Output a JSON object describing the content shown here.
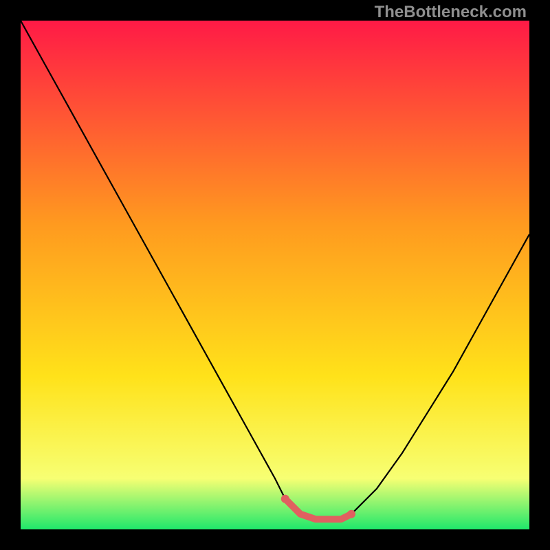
{
  "watermark": "TheBottleneck.com",
  "colors": {
    "frame": "#000000",
    "gradient_top": "#ff1a46",
    "gradient_mid1": "#ff9a1f",
    "gradient_mid2": "#ffe21a",
    "gradient_low": "#f7ff73",
    "gradient_bottom": "#1fe86b",
    "curve": "#000000",
    "segment": "#e06060"
  },
  "chart_data": {
    "type": "line",
    "title": "",
    "xlabel": "",
    "ylabel": "",
    "xlim": [
      0,
      100
    ],
    "ylim": [
      0,
      100
    ],
    "series": [
      {
        "name": "bottleneck-curve",
        "x": [
          0,
          5,
          10,
          15,
          20,
          25,
          30,
          35,
          40,
          45,
          50,
          52,
          55,
          58,
          60,
          63,
          65,
          70,
          75,
          80,
          85,
          90,
          95,
          100
        ],
        "y": [
          100,
          91,
          82,
          73,
          64,
          55,
          46,
          37,
          28,
          19,
          10,
          6,
          3,
          2,
          2,
          2,
          3,
          8,
          15,
          23,
          31,
          40,
          49,
          58
        ]
      }
    ],
    "highlight_segment": {
      "name": "trough",
      "x": [
        52,
        55,
        58,
        60,
        63,
        65
      ],
      "y": [
        6,
        3,
        2,
        2,
        2,
        3
      ]
    }
  }
}
